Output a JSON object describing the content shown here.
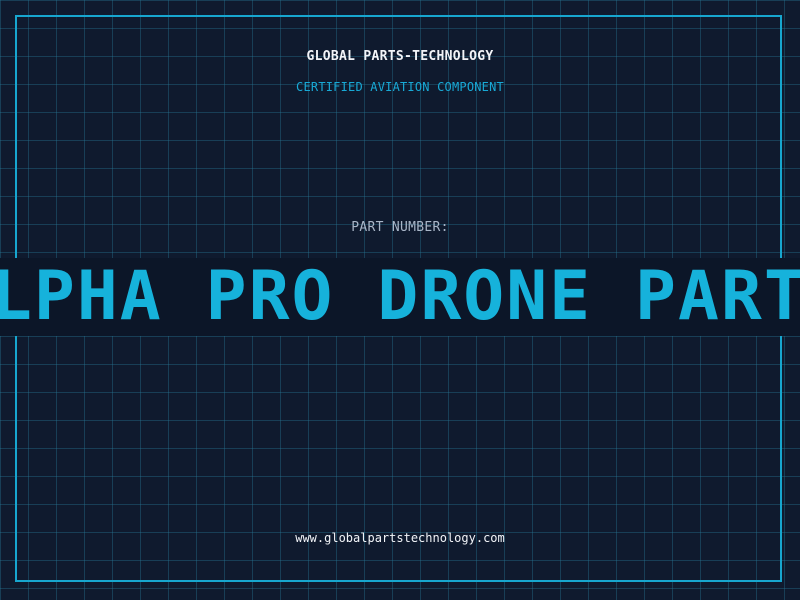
{
  "header": {
    "company": "GLOBAL PARTS-TECHNOLOGY",
    "subtitle": "CERTIFIED AVIATION COMPONENT"
  },
  "part": {
    "label": "PART NUMBER:",
    "value": "ALPHA PRO DRONE PARTS"
  },
  "footer": {
    "url": "www.globalpartstechnology.com"
  },
  "colors": {
    "background": "#0f1a2e",
    "accent": "#17a6cf",
    "text": "#f2f4f8",
    "muted": "#a9b6c8"
  }
}
